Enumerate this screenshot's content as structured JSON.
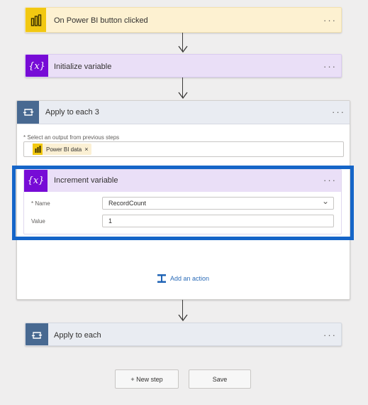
{
  "steps": {
    "trigger": {
      "title": "On Power BI button clicked",
      "icon": "power-bi-icon",
      "color": "#f2c811"
    },
    "init_var": {
      "title": "Initialize variable",
      "icon": "variable-icon",
      "color": "#770bd6"
    },
    "apply_each_3": {
      "title": "Apply to each 3",
      "icon": "loop-icon",
      "color": "#486991",
      "select_label": "* Select an output from previous steps",
      "token_label": "Power BI data",
      "token_remove": "×"
    },
    "increment": {
      "title": "Increment variable",
      "icon": "variable-icon",
      "name_label": "* Name",
      "name_value": "RecordCount",
      "value_label": "Value",
      "value_value": "1"
    },
    "add_action": "Add an action",
    "apply_each": {
      "title": "Apply to each",
      "icon": "loop-icon"
    }
  },
  "menu_glyph": "···",
  "dropdown_glyph": "⌄",
  "buttons": {
    "new_step": "+ New step",
    "save": "Save"
  },
  "highlight_color": "#1565c8"
}
